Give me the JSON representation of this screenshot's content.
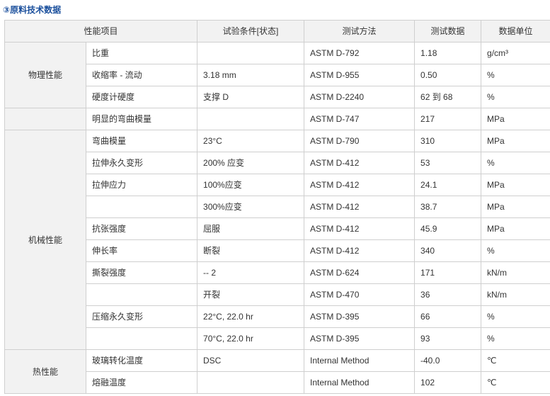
{
  "title": "③原料技术数据",
  "headers": {
    "property": "性能项目",
    "condition": "试验条件[状态]",
    "method": "测试方法",
    "value": "测试数据",
    "unit": "数据单位"
  },
  "categories": {
    "physical": "物理性能",
    "mechanical": "机械性能",
    "thermal": "热性能"
  },
  "rows": [
    {
      "name": "比重",
      "condition": "",
      "method": "ASTM D-792",
      "value": "1.18",
      "unit": "g/cm³"
    },
    {
      "name": "收缩率 - 流动",
      "condition": "3.18 mm",
      "method": "ASTM D-955",
      "value": "0.50",
      "unit": "%"
    },
    {
      "name": "硬度计硬度",
      "condition": "支撑 D",
      "method": "ASTM D-2240",
      "value": "62 到 68",
      "unit": "%"
    },
    {
      "name": "明显的弯曲模量",
      "condition": "",
      "method": "ASTM D-747",
      "value": "217",
      "unit": "MPa"
    },
    {
      "name": "弯曲模量",
      "condition": "23°C",
      "method": "ASTM D-790",
      "value": "310",
      "unit": "MPa"
    },
    {
      "name": "拉伸永久变形",
      "condition": "200% 应变",
      "method": "ASTM D-412",
      "value": "53",
      "unit": "%"
    },
    {
      "name": "拉伸应力",
      "condition": "100%应变",
      "method": "ASTM D-412",
      "value": "24.1",
      "unit": "MPa"
    },
    {
      "name": "",
      "condition": "300%应变",
      "method": "ASTM D-412",
      "value": "38.7",
      "unit": "MPa"
    },
    {
      "name": "抗张强度",
      "condition": "屈服",
      "method": "ASTM D-412",
      "value": "45.9",
      "unit": "MPa"
    },
    {
      "name": "伸长率",
      "condition": "断裂",
      "method": "ASTM D-412",
      "value": "340",
      "unit": "%"
    },
    {
      "name": "撕裂强度",
      "condition": "-- 2",
      "method": "ASTM D-624",
      "value": "171",
      "unit": "kN/m"
    },
    {
      "name": "",
      "condition": "开裂",
      "method": "ASTM D-470",
      "value": "36",
      "unit": "kN/m"
    },
    {
      "name": "压缩永久变形",
      "condition": "22°C, 22.0 hr",
      "method": "ASTM D-395",
      "value": "66",
      "unit": "%"
    },
    {
      "name": "",
      "condition": "70°C, 22.0 hr",
      "method": "ASTM D-395",
      "value": "93",
      "unit": "%"
    },
    {
      "name": "玻璃转化温度",
      "condition": "DSC",
      "method": "Internal Method",
      "value": " -40.0",
      "unit": "℃"
    },
    {
      "name": "熔融温度",
      "condition": "",
      "method": "Internal Method",
      "value": "102",
      "unit": "℃"
    }
  ]
}
